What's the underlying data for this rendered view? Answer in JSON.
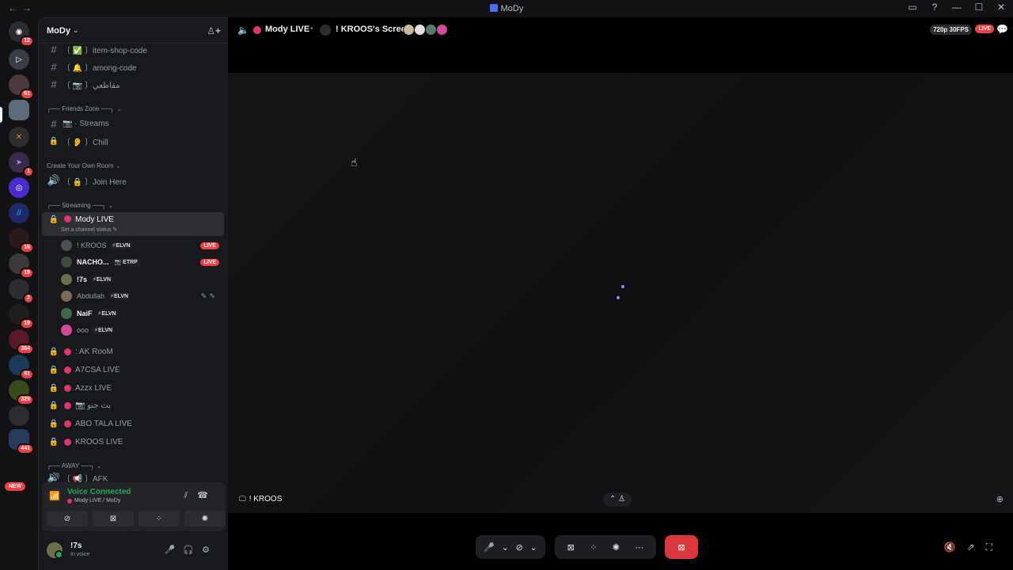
{
  "window": {
    "title": "MoDy",
    "nav_back": "←",
    "nav_forward": "→",
    "controls": [
      "▭",
      "?",
      "—",
      "☐",
      "✕"
    ]
  },
  "guild_badges": [
    "12",
    "61",
    "1",
    "16",
    "19",
    "2",
    "19",
    "364",
    "61",
    "329",
    "441"
  ],
  "guild_new": "NEW",
  "server": {
    "name": "MoDy",
    "chev": "⌄",
    "invite": "♙+"
  },
  "channels": {
    "item_shop": "〔 ✅ 〕item-shop-code",
    "among": "〔 🔔 〕among-code",
    "arabic": "〔 📷 〕مقاطعي",
    "cat_friends": "┌── Friends Zone ──┐",
    "streams": "📷 · Streams",
    "chill": "〔 👂 〕Chill",
    "cat_create": "Create Your Own Room",
    "join_here": "〔 🔒 〕Join Here",
    "cat_streaming": "┌── Streaming ──┐",
    "mody_live": "Mody LIVE",
    "mody_live_status": "Set a channel status ✎",
    "ak_room": ": AK RooM",
    "a7csa": "A7CSA LIVE",
    "azzx": "Azzx LIVE",
    "arabic2": "📷 بث جنو",
    "abo_tala": "ABO TALA LIVE",
    "kroos_live": "KROOS LIVE",
    "cat_away": "┌── AWAY ──┐",
    "afk": "〔 📢 〕AFK"
  },
  "voice_users": [
    {
      "name": "! KROOS",
      "tag": "⚡ELVN",
      "live": "LIVE"
    },
    {
      "name": "NACHO...",
      "tag": "📷 ETRP",
      "live": "LIVE"
    },
    {
      "name": "!7s",
      "tag": "⚡ELVN",
      "live": ""
    },
    {
      "name": "Abdullah",
      "tag": "⚡ELVN",
      "live": ""
    },
    {
      "name": "NaiF",
      "tag": "⚡ELVN",
      "live": ""
    },
    {
      "name": "ooo",
      "tag": "⚡ELVN",
      "live": ""
    }
  ],
  "voice_panel": {
    "status": "Voice Connected",
    "location": "Mody LIVE / MoDy"
  },
  "user": {
    "name": "!7s",
    "status": "In voice"
  },
  "stage": {
    "channel": "Mody LIVE",
    "screen": "! KROOS's Screen",
    "quality": "720p 30FPS",
    "live": "LIVE",
    "streamer": "! KROOS"
  },
  "colors": {
    "live_red": "#f23f43",
    "voice_green": "#23a55a",
    "channel_dot": "#e0356a"
  }
}
